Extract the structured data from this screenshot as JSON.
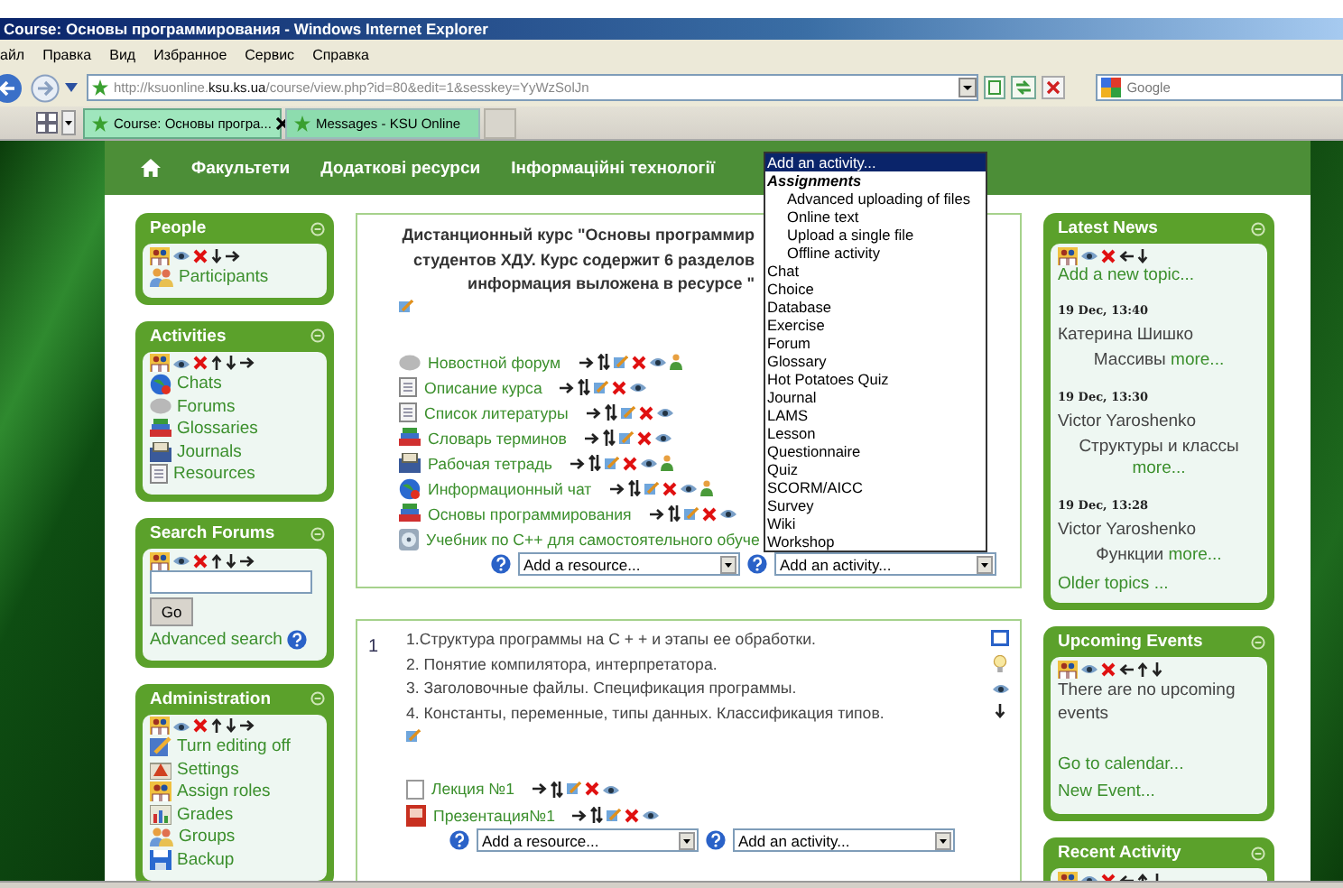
{
  "window": {
    "title": "Course: Основы программирования - Windows Internet Explorer"
  },
  "menu": [
    "айл",
    "Правка",
    "Вид",
    "Избранное",
    "Сервис",
    "Справка"
  ],
  "address": {
    "url_start": "http://ksuonline.",
    "url_domain": "ksu.ks.ua",
    "url_rest": "/course/view.php?id=80&edit=1&sesskey=YyWzSolJn"
  },
  "search": {
    "placeholder": "Google"
  },
  "tabs": [
    {
      "label": "Course: Основы програ...",
      "selected": true
    },
    {
      "label": "Messages - KSU Online",
      "selected": false
    }
  ],
  "nav": {
    "items": [
      "Факультети",
      "Додаткові ресурси",
      "Інформаційні технології"
    ]
  },
  "left_blocks": [
    {
      "kind": "links",
      "title": "People",
      "items": [
        "Participants"
      ]
    },
    {
      "kind": "links",
      "title": "Activities",
      "items": [
        "Chats",
        "Forums",
        "Glossaries",
        "Journals",
        "Resources"
      ]
    },
    {
      "kind": "search",
      "title": "Search Forums",
      "button": "Go",
      "link": "Advanced search"
    },
    {
      "kind": "links",
      "title": "Administration",
      "items": [
        "Turn editing off",
        "Settings",
        "Assign roles",
        "Grades",
        "Groups",
        "Backup"
      ]
    }
  ],
  "sections": [
    {
      "kind": "intro",
      "summary": [
        "Дистанционный курс \"Основы программир",
        "студентов ХДУ. Курс содержит 6 разделов",
        "информация выложена в ресурсе \""
      ],
      "activities": [
        {
          "label": "Новостной форум",
          "controls": true,
          "group_mode": true
        },
        {
          "label": "Описание курса",
          "controls": true,
          "group_mode": false
        },
        {
          "label": "Список литературы",
          "controls": true,
          "group_mode": false
        },
        {
          "label": "Словарь терминов",
          "controls": true,
          "group_mode": false
        },
        {
          "label": "Рабочая тетрадь",
          "controls": true,
          "group_mode": true
        },
        {
          "label": "Информационный чат",
          "controls": true,
          "group_mode": true
        },
        {
          "label": "Основы программирования",
          "controls": true,
          "group_mode": false
        },
        {
          "label": "Учебник по С++ для самостоятельного обуче",
          "group_mode": false
        }
      ],
      "resource_select": "Add a resource...",
      "activity_select": "Add an activity..."
    },
    {
      "kind": "topic",
      "number": "1",
      "summary": [
        "1.Структура программы на С + + и этапы ее обработки.",
        "2. Понятие компилятора, интерпретатора.",
        "3. Заголовочные файлы. Спецификация программы.",
        "4. Константы, переменные, типы данных. Классификация типов."
      ],
      "activities": [
        {
          "label": "Лекция №1",
          "controls": true,
          "group_mode": false
        },
        {
          "label": "Презентация№1",
          "controls": true,
          "group_mode": false
        }
      ],
      "resource_select": "Add a resource...",
      "activity_select": "Add an activity..."
    }
  ],
  "right_blocks": [
    {
      "kind": "news",
      "title": "Latest News",
      "add_link": "Add a new topic...",
      "posts": [
        {
          "date": "19 Dec, 13:40",
          "author": "Катерина Шишко",
          "subject": "Массивы",
          "more": "more..."
        },
        {
          "date": "19 Dec, 13:30",
          "author": "Victor Yaroshenko",
          "subject": "Структуры и классы",
          "more": "more..."
        },
        {
          "date": "19 Dec, 13:28",
          "author": "Victor Yaroshenko",
          "subject": "Функции",
          "more": "more..."
        }
      ],
      "older": "Older topics ..."
    },
    {
      "kind": "events",
      "title": "Upcoming Events",
      "text": "There are no upcoming events",
      "links": [
        "Go to calendar...",
        "New Event..."
      ]
    },
    {
      "kind": "recent",
      "title": "Recent Activity"
    }
  ],
  "activity_menu": {
    "items": [
      {
        "label": "Add an activity...",
        "kind": "option",
        "selected": true
      },
      {
        "label": "Assignments",
        "kind": "group"
      },
      {
        "label": "Advanced uploading of files",
        "kind": "suboption",
        "selected": false
      },
      {
        "label": "Online text",
        "kind": "suboption",
        "selected": false
      },
      {
        "label": "Upload a single file",
        "kind": "suboption",
        "selected": false
      },
      {
        "label": "Offline activity",
        "kind": "suboption",
        "selected": false
      },
      {
        "label": "Chat",
        "kind": "option",
        "selected": false
      },
      {
        "label": "Choice",
        "kind": "option",
        "selected": false
      },
      {
        "label": "Database",
        "kind": "option",
        "selected": false
      },
      {
        "label": "Exercise",
        "kind": "option",
        "selected": false
      },
      {
        "label": "Forum",
        "kind": "option",
        "selected": false
      },
      {
        "label": "Glossary",
        "kind": "option",
        "selected": false
      },
      {
        "label": "Hot Potatoes Quiz",
        "kind": "option",
        "selected": false
      },
      {
        "label": "Journal",
        "kind": "option",
        "selected": false
      },
      {
        "label": "LAMS",
        "kind": "option",
        "selected": false
      },
      {
        "label": "Lesson",
        "kind": "option",
        "selected": false
      },
      {
        "label": "Questionnaire",
        "kind": "option",
        "selected": false
      },
      {
        "label": "Quiz",
        "kind": "option",
        "selected": false
      },
      {
        "label": "SCORM/AICC",
        "kind": "option",
        "selected": false
      },
      {
        "label": "Survey",
        "kind": "option",
        "selected": false
      },
      {
        "label": "Wiki",
        "kind": "option",
        "selected": false
      },
      {
        "label": "Workshop",
        "kind": "option",
        "selected": false
      }
    ]
  }
}
